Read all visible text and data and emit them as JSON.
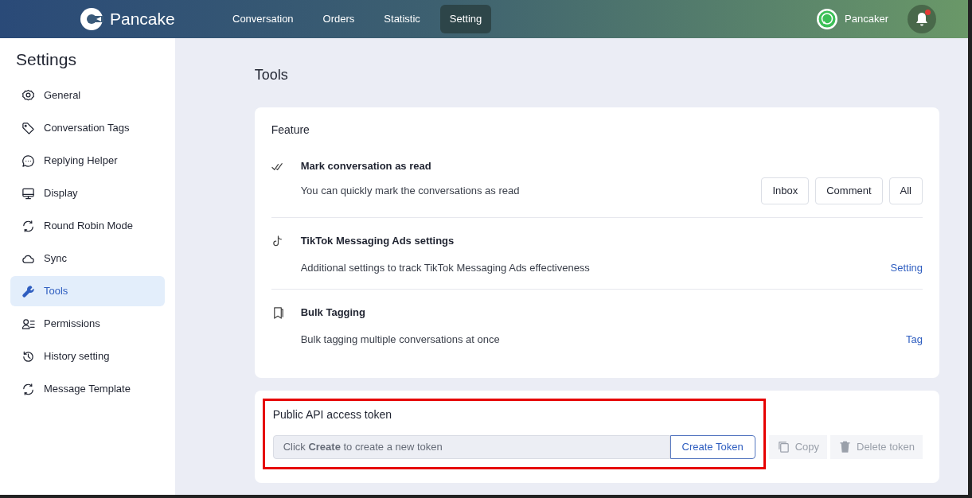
{
  "navbar": {
    "brand": "Pancake",
    "tabs": [
      {
        "label": "Conversation",
        "selected": false
      },
      {
        "label": "Orders",
        "selected": false
      },
      {
        "label": "Statistic",
        "selected": false
      },
      {
        "label": "Setting",
        "selected": true
      }
    ],
    "user": "Pancaker",
    "notification_unread": true
  },
  "sidebar": {
    "title": "Settings",
    "items": [
      {
        "label": "General",
        "selected": false
      },
      {
        "label": "Conversation Tags",
        "selected": false
      },
      {
        "label": "Replying Helper",
        "selected": false
      },
      {
        "label": "Display",
        "selected": false
      },
      {
        "label": "Round Robin Mode",
        "selected": false
      },
      {
        "label": "Sync",
        "selected": false
      },
      {
        "label": "Tools",
        "selected": true
      },
      {
        "label": "Permissions",
        "selected": false
      },
      {
        "label": "History setting",
        "selected": false
      },
      {
        "label": "Message Template",
        "selected": false
      }
    ]
  },
  "page_title": "Tools",
  "feature": {
    "title": "Feature",
    "items": [
      {
        "title": "Mark conversation as read",
        "description": "You can quickly mark the conversations as read",
        "kind": "buttons",
        "actions": [
          "Inbox",
          "Comment",
          "All"
        ]
      },
      {
        "title": "TikTok Messaging Ads settings",
        "description": "Additional settings to track TikTok Messaging Ads effectiveness",
        "kind": "link",
        "actions": [
          "Setting"
        ]
      },
      {
        "title": "Bulk Tagging",
        "description": "Bulk tagging multiple conversations at once",
        "kind": "link",
        "actions": [
          "Tag"
        ]
      }
    ]
  },
  "api_token": {
    "title": "Public API access token",
    "highlighted": true,
    "field_text": "Click **Create** to create a new token",
    "create_button": "Create Token",
    "buttons": [
      {
        "label": "Copy",
        "disabled": true
      },
      {
        "label": "Delete token",
        "disabled": true
      }
    ]
  }
}
